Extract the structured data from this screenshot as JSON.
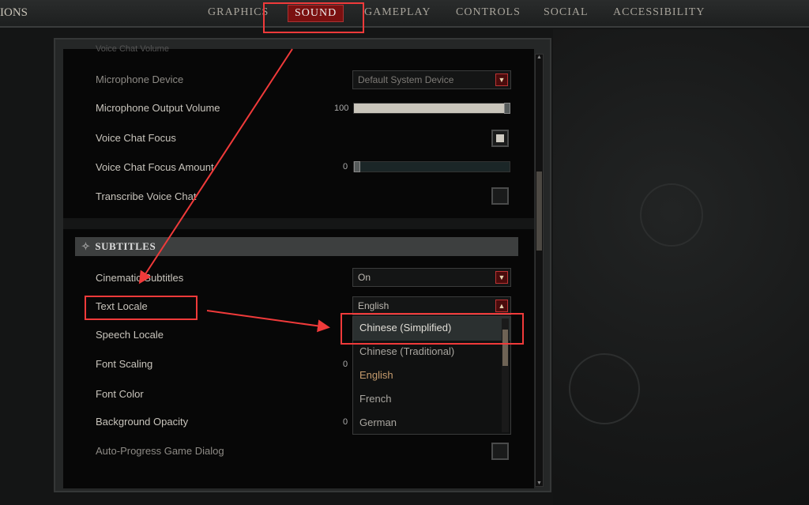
{
  "header": {
    "title": "IONS",
    "tabs": [
      {
        "label": "GRAPHICS"
      },
      {
        "label": "SOUND",
        "active": true
      },
      {
        "label": "GAMEPLAY"
      },
      {
        "label": "CONTROLS"
      },
      {
        "label": "SOCIAL"
      },
      {
        "label": "ACCESSIBILITY"
      }
    ]
  },
  "voice": {
    "cut_label": "Voice Chat Volume",
    "microphone_device": {
      "label": "Microphone Device",
      "value": "Default System Device"
    },
    "mic_output_volume": {
      "label": "Microphone Output Volume",
      "value": "100",
      "fraction": 1.0
    },
    "voice_chat_focus": {
      "label": "Voice Chat Focus",
      "checked": true
    },
    "voice_chat_focus_amount": {
      "label": "Voice Chat Focus Amount",
      "value": "0",
      "fraction": 0
    },
    "transcribe_voice_chat": {
      "label": "Transcribe Voice Chat",
      "checked": false
    }
  },
  "subtitles": {
    "header": "SUBTITLES",
    "cinematic_subtitles": {
      "label": "Cinematic Subtitles",
      "value": "On"
    },
    "text_locale": {
      "label": "Text Locale",
      "value": "English",
      "options": [
        "Chinese (Simplified)",
        "Chinese (Traditional)",
        "English",
        "French",
        "German"
      ],
      "highlighted": "Chinese (Simplified)"
    },
    "speech_locale": {
      "label": "Speech Locale"
    },
    "font_scaling": {
      "label": "Font Scaling",
      "value": "0"
    },
    "font_color": {
      "label": "Font Color"
    },
    "background_opacity": {
      "label": "Background Opacity",
      "value": "0"
    },
    "auto_progress": {
      "label": "Auto-Progress Game Dialog",
      "checked": false
    }
  },
  "annotation_color": "#f03a3a"
}
